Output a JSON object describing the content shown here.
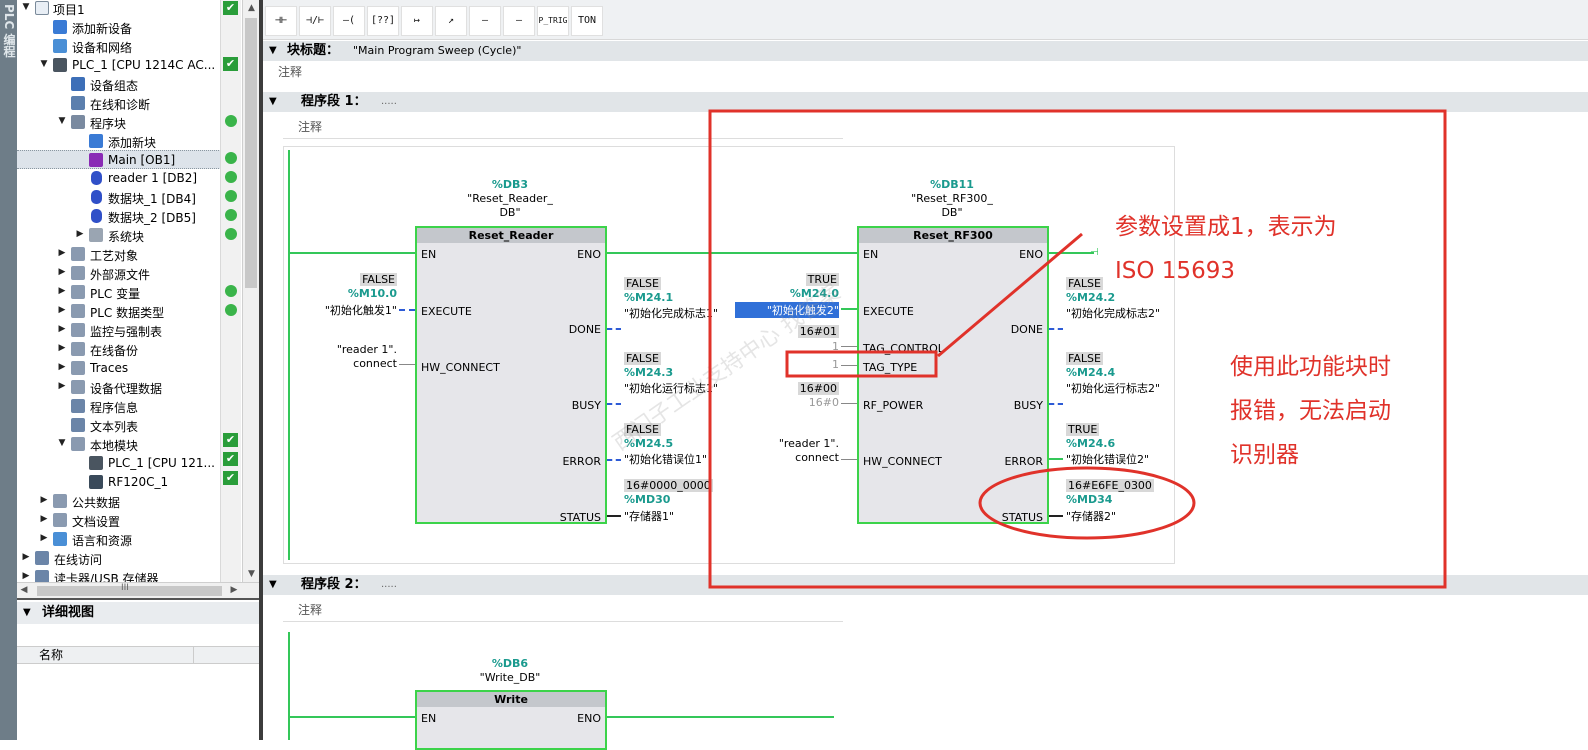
{
  "sidebar_strip": "PLC 编程",
  "tree": {
    "items": [
      {
        "label": "项目1",
        "status": "check"
      },
      {
        "label": "添加新设备",
        "status": ""
      },
      {
        "label": "设备和网络",
        "status": ""
      },
      {
        "label": "PLC_1 [CPU 1214C AC...",
        "status": "check"
      },
      {
        "label": "设备组态",
        "status": ""
      },
      {
        "label": "在线和诊断",
        "status": ""
      },
      {
        "label": "程序块",
        "status": "dot"
      },
      {
        "label": "添加新块",
        "status": ""
      },
      {
        "label": "Main [OB1]",
        "status": "dot"
      },
      {
        "label": "reader 1 [DB2]",
        "status": "dot"
      },
      {
        "label": "数据块_1 [DB4]",
        "status": "dot"
      },
      {
        "label": "数据块_2 [DB5]",
        "status": "dot"
      },
      {
        "label": "系统块",
        "status": "dot"
      },
      {
        "label": "工艺对象",
        "status": ""
      },
      {
        "label": "外部源文件",
        "status": ""
      },
      {
        "label": "PLC 变量",
        "status": "dot"
      },
      {
        "label": "PLC 数据类型",
        "status": "dot"
      },
      {
        "label": "监控与强制表",
        "status": ""
      },
      {
        "label": "在线备份",
        "status": ""
      },
      {
        "label": "Traces",
        "status": ""
      },
      {
        "label": "设备代理数据",
        "status": ""
      },
      {
        "label": "程序信息",
        "status": ""
      },
      {
        "label": "文本列表",
        "status": ""
      },
      {
        "label": "本地模块",
        "status": "check"
      },
      {
        "label": "PLC_1 [CPU 121...",
        "status": "check"
      },
      {
        "label": "RF120C_1",
        "status": "check"
      },
      {
        "label": "公共数据",
        "status": ""
      },
      {
        "label": "文档设置",
        "status": ""
      },
      {
        "label": "语言和资源",
        "status": ""
      },
      {
        "label": "在线访问",
        "status": ""
      },
      {
        "label": "读卡器/USB 存储器",
        "status": ""
      }
    ],
    "hscroll_label": "III"
  },
  "detail": {
    "title": "详细视图",
    "col_name": "名称"
  },
  "toolbar": {
    "buttons": [
      "⊣⊢",
      "⊣/⊢",
      "–( )–",
      "[??]",
      "↦",
      "↗",
      "–(S)–",
      "–(R)–",
      "P_TRIG",
      "TON"
    ]
  },
  "block": {
    "title_label": "块标题：",
    "title_value": "\"Main Program Sweep (Cycle)\"",
    "note": "注释"
  },
  "network1": {
    "label": "程序段 1：",
    "dots": ".....",
    "note": "注释",
    "fb1": {
      "db_addr": "%DB3",
      "db_name": "\"Reset_Reader_DB\"",
      "db_name_l1": "\"Reset_Reader_",
      "db_name_l2": "DB\"",
      "type": "Reset_Reader",
      "in_pins": [
        "EN",
        "EXECUTE",
        "HW_CONNECT"
      ],
      "out_pins": [
        "ENO",
        "DONE",
        "BUSY",
        "ERROR",
        "STATUS"
      ],
      "execute_state": "FALSE",
      "execute_addr": "%M10.0",
      "execute_tag": "\"初始化触发1\"",
      "hw_tag_l1": "\"reader 1\".",
      "hw_tag_l2": "connect",
      "done_state": "FALSE",
      "done_addr": "%M24.1",
      "done_tag": "\"初始化完成标志1\"",
      "busy_state": "FALSE",
      "busy_addr": "%M24.3",
      "busy_tag": "\"初始化运行标志1\"",
      "error_state": "FALSE",
      "error_addr": "%M24.5",
      "error_tag": "\"初始化错误位1\"",
      "status_state": "16#0000_0000",
      "status_addr": "%MD30",
      "status_tag": "\"存储器1\""
    },
    "fb2": {
      "db_addr": "%DB11",
      "db_name_l1": "\"Reset_RF300_",
      "db_name_l2": "DB\"",
      "type": "Reset_RF300",
      "in_pins": [
        "EN",
        "EXECUTE",
        "TAG_CONTROL",
        "TAG_TYPE",
        "RF_POWER",
        "HW_CONNECT"
      ],
      "out_pins": [
        "ENO",
        "DONE",
        "BUSY",
        "ERROR",
        "STATUS"
      ],
      "execute_state": "TRUE",
      "execute_addr": "%M24.0",
      "execute_tag": "\"初始化触发2\"",
      "tagctl_val": "16#01",
      "tagctl_default": "1",
      "tagtype_val": "1",
      "rfpower_val": "16#00",
      "rfpower_default": "16#0",
      "hw_tag_l1": "\"reader 1\".",
      "hw_tag_l2": "connect",
      "done_state": "FALSE",
      "done_addr": "%M24.2",
      "done_tag": "\"初始化完成标志2\"",
      "busy_state": "FALSE",
      "busy_addr": "%M24.4",
      "busy_tag": "\"初始化运行标志2\"",
      "error_state": "TRUE",
      "error_addr": "%M24.6",
      "error_tag": "\"初始化错误位2\"",
      "status_state": "16#E6FE_0300",
      "status_addr": "%MD34",
      "status_tag": "\"存储器2\""
    }
  },
  "network2": {
    "label": "程序段 2：",
    "dots": ".....",
    "note": "注释",
    "fb": {
      "db_addr": "%DB6",
      "db_name": "\"Write_DB\"",
      "type": "Write",
      "pin_en": "EN",
      "pin_eno": "ENO"
    }
  },
  "annotations": {
    "text1_l1": "参数设置成1，表示为",
    "text1_l2": "ISO 15693",
    "text2_l1": "使用此功能块时",
    "text2_l2": "报错，无法启动",
    "text2_l3": "识别器",
    "color": "#e0322a"
  },
  "watermark": "西门子工业支持中心 support.industry.siemens.com/cs 找答案"
}
